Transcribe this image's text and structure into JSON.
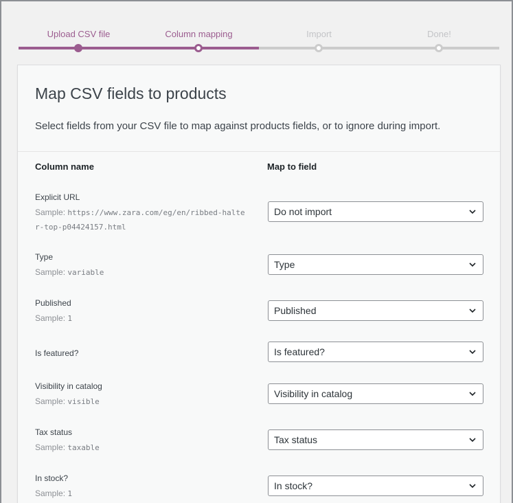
{
  "steps": [
    {
      "label": "Upload CSV file",
      "state": "done"
    },
    {
      "label": "Column mapping",
      "state": "active"
    },
    {
      "label": "Import",
      "state": "todo"
    },
    {
      "label": "Done!",
      "state": "todo"
    }
  ],
  "colors": {
    "accent": "#9b5c8f",
    "inactive": "#cccccc"
  },
  "card": {
    "title": "Map CSV fields to products",
    "description": "Select fields from your CSV file to map against products fields, or to ignore during import.",
    "column_name_header": "Column name",
    "map_to_field_header": "Map to field",
    "sample_prefix": "Sample:"
  },
  "rows": [
    {
      "name": "Explicit URL",
      "sample": "https://www.zara.com/eg/en/ribbed-halter-top-p04424157.html",
      "mapped": "Do not import"
    },
    {
      "name": "Type",
      "sample": "variable",
      "mapped": "Type"
    },
    {
      "name": "Published",
      "sample": "1",
      "mapped": "Published"
    },
    {
      "name": "Is featured?",
      "sample": "",
      "mapped": "Is featured?"
    },
    {
      "name": "Visibility in catalog",
      "sample": "visible",
      "mapped": "Visibility in catalog"
    },
    {
      "name": "Tax status",
      "sample": "taxable",
      "mapped": "Tax status"
    },
    {
      "name": "In stock?",
      "sample": "1",
      "mapped": "In stock?"
    }
  ],
  "icons": {
    "select_chevron": "chevron-down-icon"
  }
}
